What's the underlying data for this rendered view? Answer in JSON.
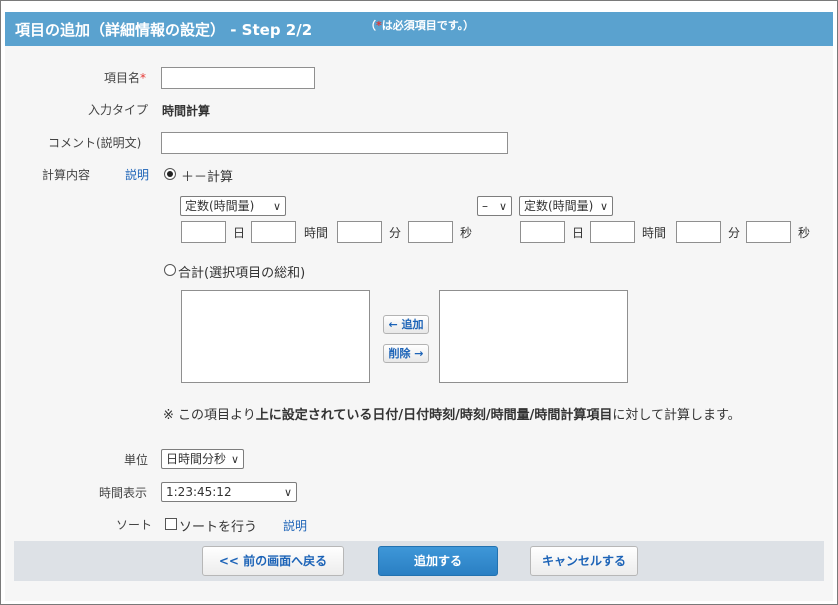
{
  "header": {
    "title": "項目の追加（詳細情報の設定） - Step 2/2",
    "note_prefix": "（",
    "note_star": "*",
    "note_text": "は必須項目です。）"
  },
  "fields": {
    "item_name": {
      "label": "項目名",
      "required_mark": "*",
      "value": ""
    },
    "input_type": {
      "label": "入力タイプ",
      "value": "時間計算"
    },
    "comment": {
      "label": "コメント(説明文)",
      "value": ""
    },
    "calc": {
      "label": "計算内容",
      "help_link": "説明",
      "option_plus_minus": "＋－計算",
      "left_select": "定数(時間量)",
      "operator_select": "–",
      "right_select": "定数(時間量)",
      "units": {
        "day": "日",
        "hour": "時間",
        "minute": "分",
        "second": "秒"
      },
      "option_sum": "合計(選択項目の総和)",
      "add_button": "← 追加",
      "remove_button": "削除 →",
      "notice_prefix": "※ この項目より",
      "notice_bold": "上に設定されている日付/日付時刻/時刻/時間量/時間計算項目",
      "notice_suffix": "に対して計算します。"
    },
    "unit": {
      "label": "単位",
      "value": "日時間分秒"
    },
    "time_display": {
      "label": "時間表示",
      "value": "1:23:45:12"
    },
    "sort": {
      "label": "ソート",
      "checkbox_label": "ソートを行う",
      "help_link": "説明"
    }
  },
  "footer": {
    "back_button": "<< 前の画面へ戻る",
    "add_button": "追加する",
    "cancel_button": "キャンセルする"
  },
  "colors": {
    "header_bg": "#5aa2cf",
    "link": "#1c63b7",
    "required": "#e53935",
    "primary_button": "#2a7fc3"
  }
}
